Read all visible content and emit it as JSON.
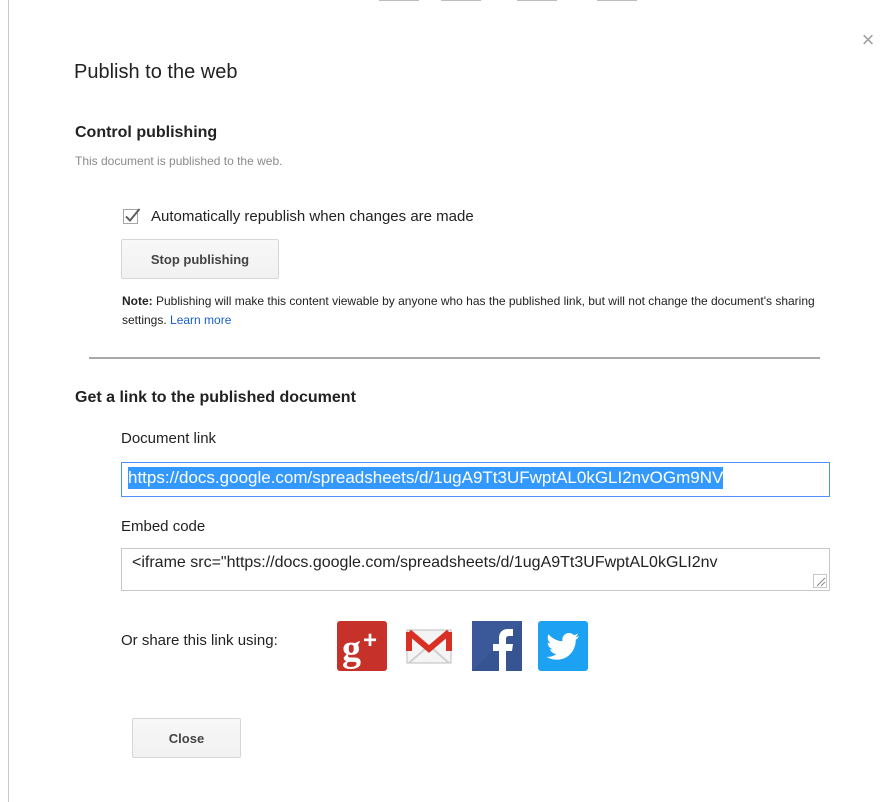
{
  "dialog": {
    "title": "Publish to the web",
    "close_glyph": "×"
  },
  "control": {
    "heading": "Control publishing",
    "status": "This document is published to the web.",
    "auto_republish_label": "Automatically republish when changes are made",
    "auto_republish_checked": true,
    "stop_button_label": "Stop publishing",
    "note_bold": "Note:",
    "note_text": " Publishing will make this content viewable by anyone who has the published link, but will not change the document's sharing settings. ",
    "learn_more": "Learn more"
  },
  "link_section": {
    "heading": "Get a link to the published document",
    "document_link_label": "Document link",
    "document_link_value": "https://docs.google.com/spreadsheets/d/1ugA9Tt3UFwptAL0kGLI2nvOGm9NV",
    "embed_label": "Embed code",
    "embed_value": "<iframe src=\"https://docs.google.com/spreadsheets/d/1ugA9Tt3UFwptAL0kGLI2nv"
  },
  "share": {
    "label": "Or share this link using:",
    "icons": [
      "google-plus-icon",
      "gmail-icon",
      "facebook-icon",
      "twitter-icon"
    ]
  },
  "footer": {
    "close_button_label": "Close"
  },
  "colors": {
    "link_blue": "#1a5fc9",
    "selection_blue": "#3399ff",
    "focus_border": "#4d90fe",
    "google_plus_red": "#c6322a",
    "gmail_red": "#d93025",
    "facebook_blue": "#3b5998",
    "twitter_blue": "#1da1f2"
  }
}
